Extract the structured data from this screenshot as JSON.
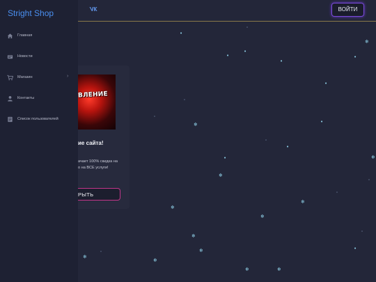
{
  "brand": "Stright Shop",
  "header": {
    "social_icon": "vk-icon",
    "social_text": "vk",
    "login_label": "ВОЙТИ"
  },
  "sidebar": {
    "items": [
      {
        "label": "Главная",
        "icon": "home-icon"
      },
      {
        "label": "Новости",
        "icon": "news-icon"
      },
      {
        "label": "Магазин",
        "icon": "cart-icon",
        "has_submenu": true
      },
      {
        "label": "Контакты",
        "icon": "user-icon"
      },
      {
        "label": "Список пользователей",
        "icon": "list-icon"
      }
    ]
  },
  "card": {
    "image_text": "ВЛЕНИЕ",
    "title": "ие сайта!",
    "desc_lines": [
      "ачает 100% скидка на",
      "о на ВСЕ услуги!"
    ],
    "button_label": "РЫТЬ"
  },
  "colors": {
    "background": "#232639",
    "sidebar": "#1e2133",
    "brand": "#4a8ff0",
    "snow": "#8fd0e8",
    "login_border": "#7a4ad8",
    "button_border": "#c2368a"
  }
}
